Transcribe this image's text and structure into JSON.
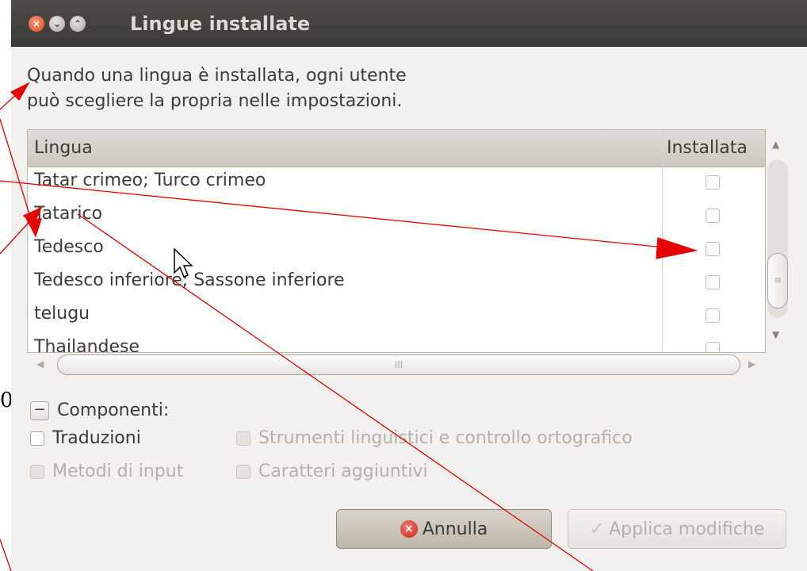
{
  "background_doc": {
    "paren": "0"
  },
  "window": {
    "title": "Lingue installate",
    "controls": {
      "close": "×",
      "minimize": "⌄",
      "maximize": "⌃"
    }
  },
  "info_text": {
    "line1": "Quando una lingua è installata, ogni utente",
    "line2": "può scegliere la propria nelle impostazioni."
  },
  "list": {
    "header_language": "Lingua",
    "header_installed": "Installata",
    "rows": [
      {
        "label": "Tatar crimeo; Turco crimeo",
        "installed": false
      },
      {
        "label": "Tatarico",
        "installed": false
      },
      {
        "label": "Tedesco",
        "installed": false
      },
      {
        "label": "Tedesco inferiore; Sassone inferiore",
        "installed": false
      },
      {
        "label": "telugu",
        "installed": false
      },
      {
        "label": "Thailandese",
        "installed": false
      }
    ]
  },
  "scroll_glyphs": {
    "up": "▲",
    "down": "▼",
    "left": "◀",
    "right": "▶",
    "grip_v": "≡",
    "grip_h": "III"
  },
  "components": {
    "expander": "−",
    "label": "Componenti:",
    "traduzioni": "Traduzioni",
    "strumenti": "Strumenti linguistici e controllo ortografico",
    "metodi": "Metodi di input",
    "caratteri": "Caratteri aggiuntivi"
  },
  "buttons": {
    "annulla": "Annulla",
    "annulla_icon": "×",
    "applica": "Applica modifiche",
    "applica_icon": "✓"
  },
  "colors": {
    "titlebar": "#3c3b37",
    "annotation_arrow": "#e60000"
  }
}
